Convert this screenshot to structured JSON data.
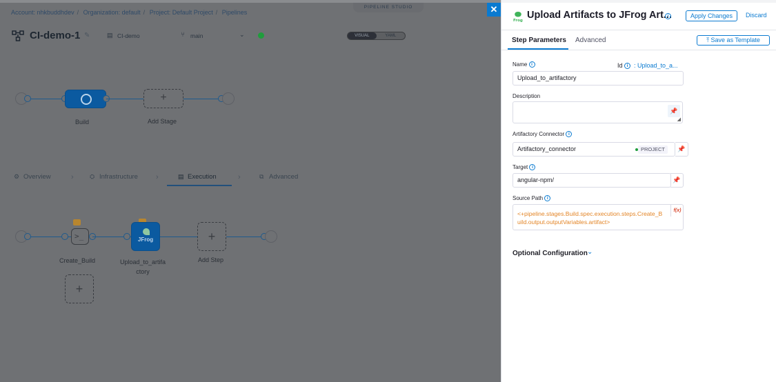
{
  "breadcrumb": {
    "account": "Account: nhkbuddhdev",
    "organization": "Organization: default",
    "project": "Project: Default Project",
    "pipelines": "Pipelines"
  },
  "studio_label": "PIPELINE STUDIO",
  "pipeline": {
    "name": "CI-demo-1",
    "repo": "CI-demo",
    "branch": "main",
    "view_toggle": [
      "VISUAL",
      "YAML"
    ],
    "active_view": "VISUAL"
  },
  "stages": {
    "build_label": "Build",
    "add_stage_label": "Add Stage"
  },
  "stage_tabs": [
    {
      "label": "Overview",
      "icon": "gear-icon"
    },
    {
      "label": "Infrastructure",
      "icon": "infrastructure-icon"
    },
    {
      "label": "Execution",
      "icon": "execution-icon"
    },
    {
      "label": "Advanced",
      "icon": "advanced-icon"
    }
  ],
  "active_stage_tab": "Execution",
  "execution": {
    "steps": [
      {
        "label": "Create_Build"
      },
      {
        "label": "Upload_to_artifa\nctory"
      }
    ],
    "add_step_label": "Add Step"
  },
  "drawer": {
    "title": "Upload Artifacts to JFrog Art...",
    "apply_changes": "Apply Changes",
    "discard": "Discard",
    "tabs": [
      "Step Parameters",
      "Advanced"
    ],
    "active_tab": "Step Parameters",
    "save_as_template": "Save as Template",
    "fields": {
      "name_label": "Name",
      "name_value": "Upload_to_artifactory",
      "id_label": "Id",
      "id_value": ": Upload_to_a...",
      "description_label": "Description",
      "description_value": "",
      "connector_label": "Artifactory Connector",
      "connector_value": "Artifactory_connector",
      "connector_scope": "PROJECT",
      "target_label": "Target",
      "target_value": "angular-npm/",
      "source_path_label": "Source Path",
      "source_path_value": "<+pipeline.stages.Build.spec.execution.steps.Create_Build.output.outputVariables.artifact>",
      "fx_label": "f(x)"
    },
    "optional_configuration": "Optional Configuration"
  },
  "colors": {
    "accent": "#0a7ad0",
    "stage_blue": "#0b5aa0",
    "expression_orange": "#e38527",
    "status_green": "#1f9d3c"
  }
}
